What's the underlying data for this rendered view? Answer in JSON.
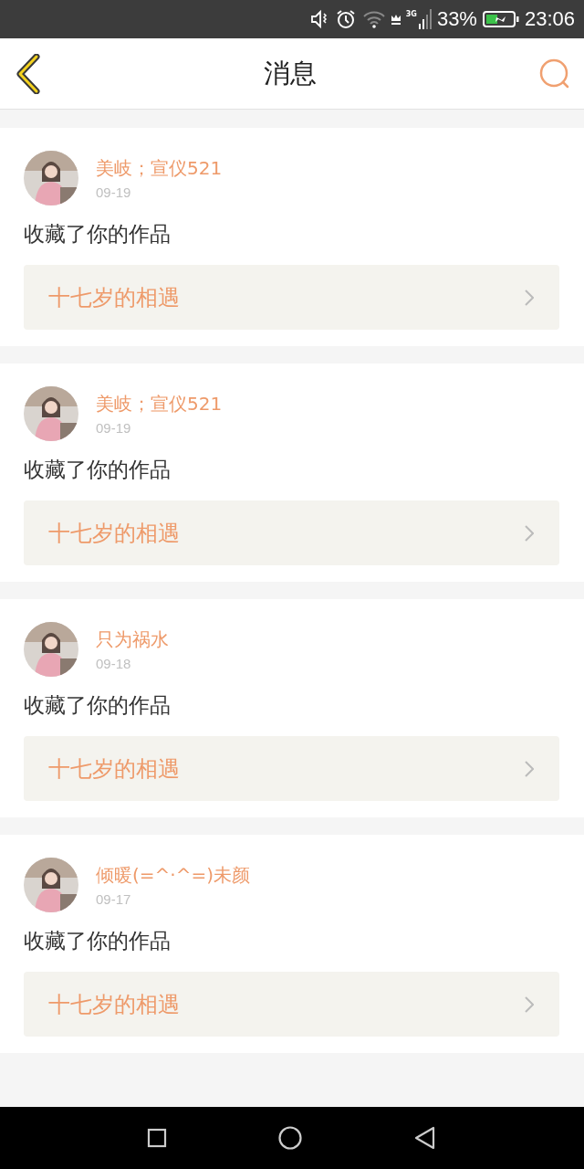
{
  "status_bar": {
    "network": "3G",
    "battery": "33%",
    "time": "23:06"
  },
  "header": {
    "title": "消息"
  },
  "messages": [
    {
      "user": "美岐；宣仪521",
      "date": "09-19",
      "action": "收藏了你的作品",
      "work": "十七岁的相遇"
    },
    {
      "user": "美岐；宣仪521",
      "date": "09-19",
      "action": "收藏了你的作品",
      "work": "十七岁的相遇"
    },
    {
      "user": "只为祸水",
      "date": "09-18",
      "action": "收藏了你的作品",
      "work": "十七岁的相遇"
    },
    {
      "user": "倾暖(=^·^=)未颜",
      "date": "09-17",
      "action": "收藏了你的作品",
      "work": "十七岁的相遇"
    }
  ]
}
